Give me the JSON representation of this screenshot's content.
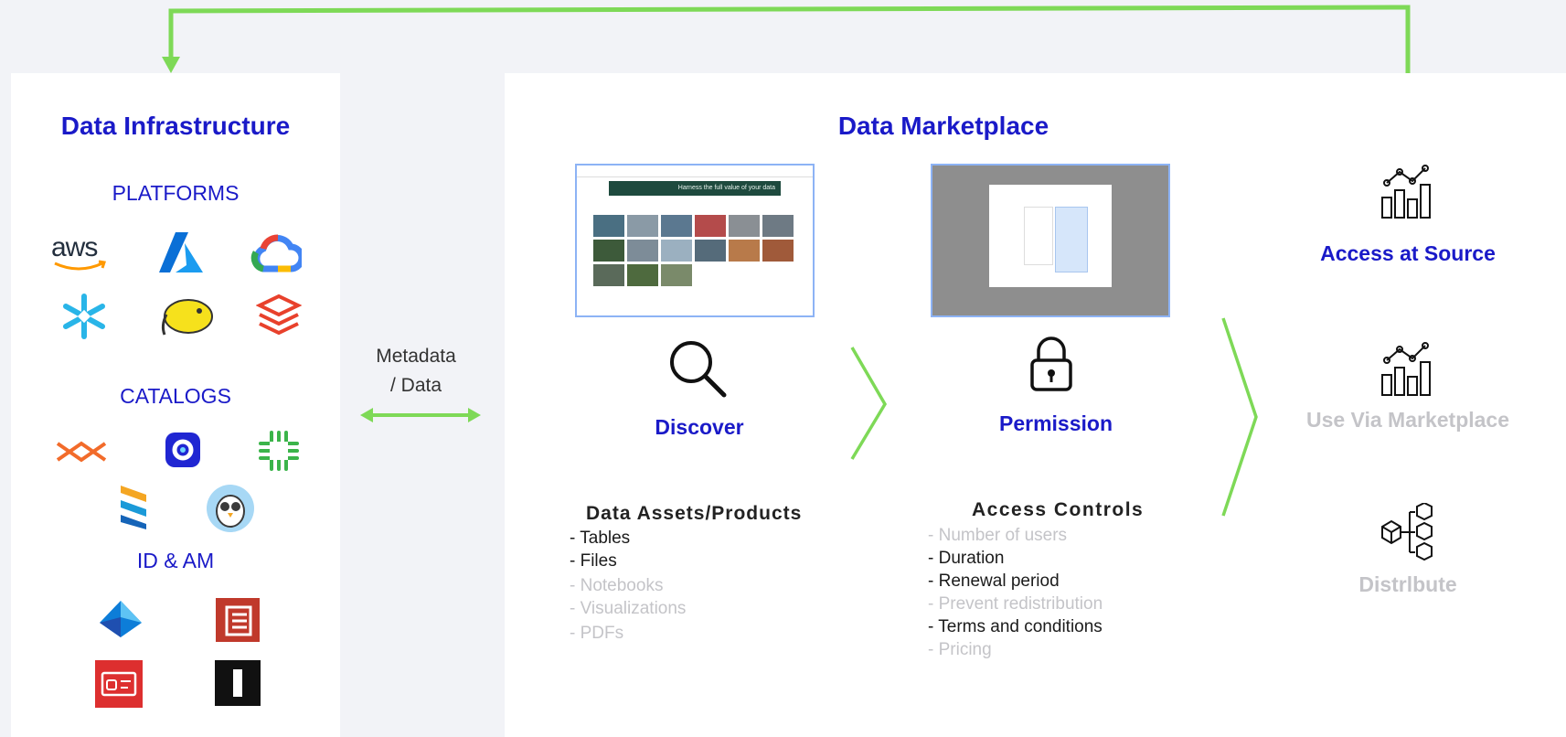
{
  "infrastructure": {
    "title": "Data Infrastructure",
    "platforms_label": "PLATFORMS",
    "catalogs_label": "CATALOGS",
    "idam_label": "ID & AM",
    "platform_logos": [
      "aws-logo",
      "azure-logo",
      "google-cloud-logo",
      "snowflake-logo",
      "hadoop-logo",
      "databricks-logo"
    ],
    "catalog_logos": [
      "informatica-logo",
      "atlan-logo",
      "collibra-logo",
      "zeenea-logo",
      "owl-logo"
    ],
    "idam_logos": [
      "azure-ad-logo",
      "aws-iam-logo",
      "aws-identity-logo",
      "okta-logo"
    ],
    "aws_text": "aws"
  },
  "connector": {
    "label_line1": "Metadata",
    "label_line2": "/ Data"
  },
  "marketplace": {
    "title": "Data Marketplace",
    "discover": {
      "label": "Discover",
      "subhead": "Data Assets/Products",
      "items": [
        {
          "text": "- Tables",
          "active": true
        },
        {
          "text": "- Files",
          "active": true
        },
        {
          "text": "- Notebooks",
          "active": false
        },
        {
          "text": "- Visualizations",
          "active": false
        },
        {
          "text": "- PDFs",
          "active": false
        }
      ],
      "banner_text": "Harness the full value of your data"
    },
    "permission": {
      "label": "Permission",
      "subhead": "Access Controls",
      "items": [
        {
          "text": "- Number of users",
          "active": false
        },
        {
          "text": "- Duration",
          "active": true
        },
        {
          "text": "- Renewal  period",
          "active": true
        },
        {
          "text": "- Prevent  redistribution",
          "active": false
        },
        {
          "text": "- Terms and conditions",
          "active": true
        },
        {
          "text": "- Pricing",
          "active": false
        }
      ]
    },
    "outcomes": [
      {
        "label": "Access at Source",
        "active": true,
        "icon": "bar-chart-icon"
      },
      {
        "label": "Use Via Marketplace",
        "active": false,
        "icon": "bar-chart-icon"
      },
      {
        "label": "Distrlbute",
        "active": false,
        "icon": "cube-network-icon"
      }
    ]
  },
  "colors": {
    "brand_blue": "#1a1ac8",
    "arrow_green": "#7ed957",
    "muted": "#c4c4c8",
    "background": "#f2f3f7"
  }
}
